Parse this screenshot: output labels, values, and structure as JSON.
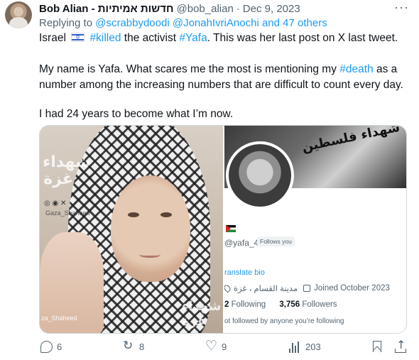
{
  "tweet": {
    "author_name": "Bob Alian - חדשות אמיתיות",
    "handle": "@bob_alian",
    "separator": "·",
    "date": "Dec 9, 2023",
    "more_label": "···",
    "replying_to_label": "Replying to",
    "replying_to_users": "@scrabbydoodi @JonahIvriAnochi and 47 others",
    "line1_start": "Israel",
    "flag_icon": "israel-flag-icon",
    "line1_hashtag1": "#killed",
    "line1_middle": "the activist",
    "line1_hashtag2": "#Yafa",
    "line1_end": ". This was her last post on X last tweet.",
    "para2_start": "My name is Yafa. What scares me the most is mentioning my",
    "para2_hashtag": "#death",
    "para2_end": "as a",
    "para2_line2": "number among the increasing numbers that are difficult to count every day.",
    "para3": "I had 24 years to become what I’m now."
  },
  "media": {
    "left_watermark": "شهداء غزة",
    "left_watermark_small": "Gaza_Shaheed",
    "left_watermark_bottom_small": "za_Shaheed",
    "right_banner_text": "شهداء فلسطين",
    "profile_handle": "@yafa_48",
    "follows_you": "Follows you",
    "translate_bio": "ranslate bio",
    "location": "مدينة القسام ، غزة",
    "joined": "Joined October 2023",
    "following_count": "2",
    "following_label": "Following",
    "followers_count": "3,756",
    "followers_label": "Followers",
    "not_followed": "ot followed by anyone you’re following"
  },
  "actions": {
    "replies": "6",
    "reposts": "8",
    "likes": "9",
    "views": "203"
  },
  "colors": {
    "link": "#1d9bf0",
    "muted": "#536471",
    "text": "#0f1419"
  }
}
